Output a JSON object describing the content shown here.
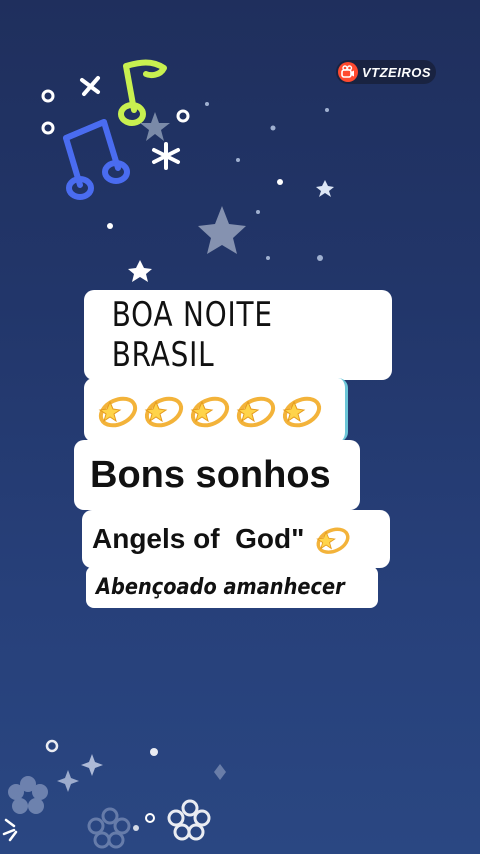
{
  "watermark": {
    "text": "VTZEIROS",
    "logo_icon": "kwai-camera-icon",
    "logo_color": "#ff4a2f"
  },
  "cards": {
    "title": "BOA NOITE BRASIL",
    "emoji_row": [
      "dizzy-star-icon",
      "dizzy-star-icon",
      "dizzy-star-icon",
      "dizzy-star-icon",
      "dizzy-star-icon"
    ],
    "subtitle": "Bons sonhos",
    "angels": "Angels of  God\"",
    "angels_icon": "dizzy-star-icon",
    "blessing": "Abençoado amanhecer"
  },
  "decorations": [
    "music-note-icon",
    "music-note-icon",
    "star-icon",
    "sparkle-icon",
    "flower-icon"
  ],
  "colors": {
    "background_top": "#1f2f5d",
    "background_bottom": "#2a4782",
    "note_yellow": "#c8f050",
    "note_blue": "#4a6cf0"
  }
}
